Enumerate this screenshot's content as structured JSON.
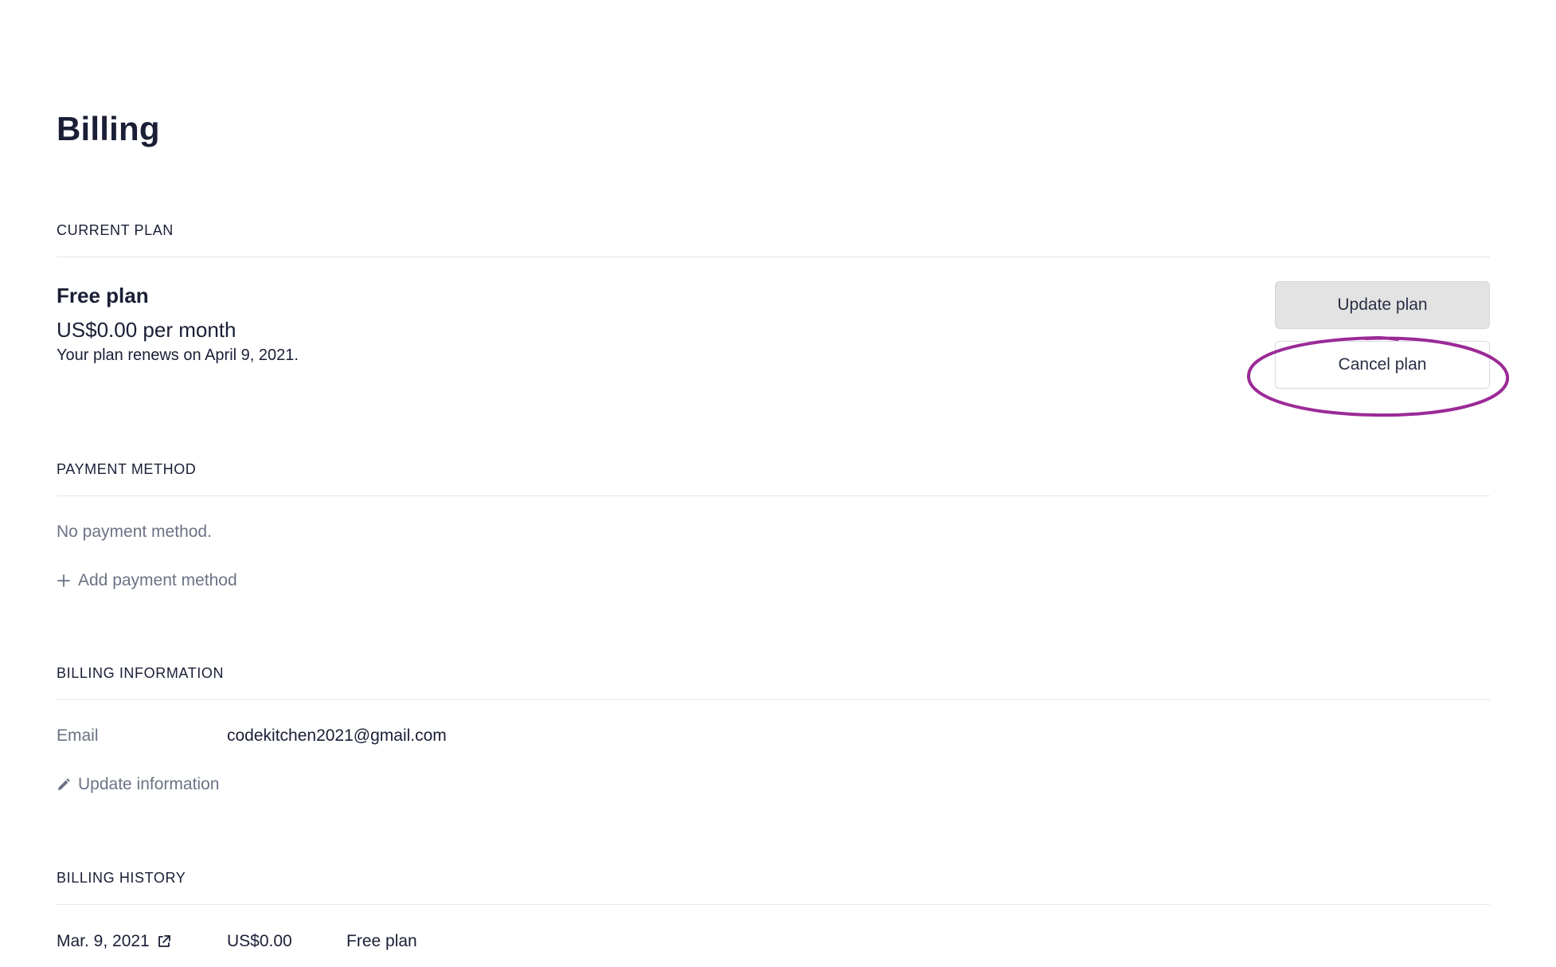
{
  "page": {
    "title": "Billing"
  },
  "current_plan": {
    "header": "CURRENT PLAN",
    "name": "Free plan",
    "price": "US$0.00 per month",
    "renewal": "Your plan renews on April 9, 2021.",
    "update_button": "Update plan",
    "cancel_button": "Cancel plan",
    "highlight_color": "#9b2a96"
  },
  "payment_method": {
    "header": "PAYMENT METHOD",
    "empty_text": "No payment method.",
    "add_label": "Add payment method",
    "add_icon": "plus-icon"
  },
  "billing_information": {
    "header": "BILLING INFORMATION",
    "email_label": "Email",
    "email_value": "codekitchen2021@gmail.com",
    "update_label": "Update information",
    "update_icon": "pencil-icon"
  },
  "billing_history": {
    "header": "BILLING HISTORY",
    "rows": [
      {
        "date": "Mar. 9, 2021",
        "amount": "US$0.00",
        "plan": "Free plan",
        "icon": "external-link-icon"
      }
    ]
  },
  "colors": {
    "text_primary": "#1a1f36",
    "text_muted": "#6b7385",
    "divider": "#e3e8ee",
    "update_button_bg": "#e3e3e3"
  }
}
